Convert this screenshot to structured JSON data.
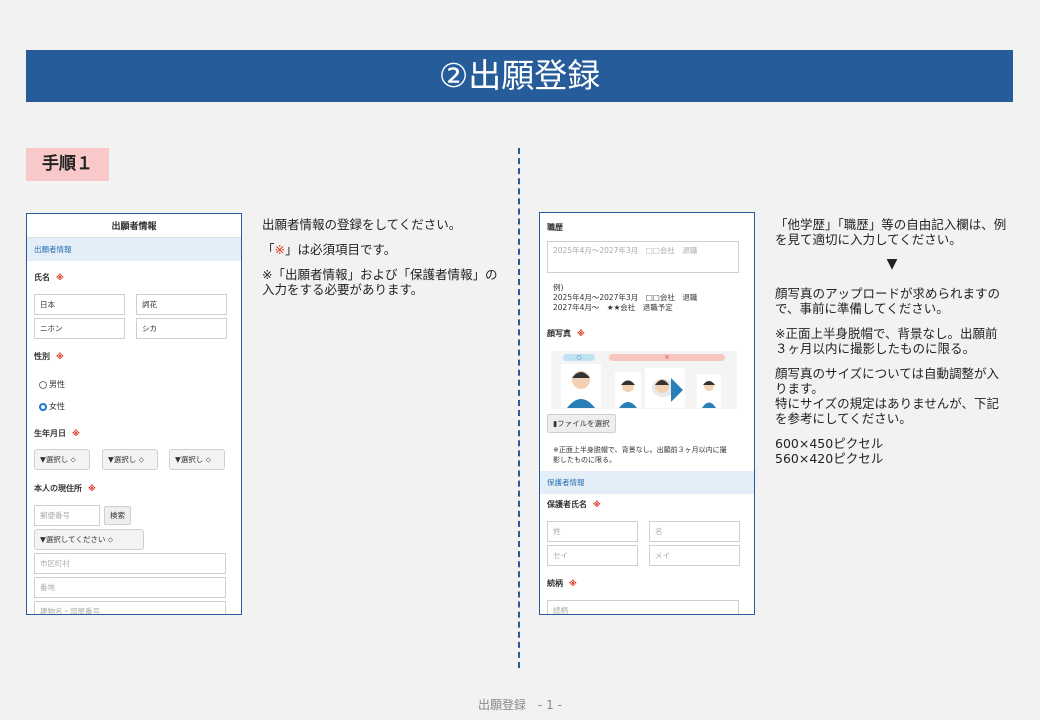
{
  "banner": {
    "title": "②出願登録"
  },
  "step": {
    "label": "手順１"
  },
  "left_text": {
    "p1": "出願者情報の登録をしてください。",
    "p2_pre": "「",
    "p2_mark": "※",
    "p2_post": "」は必須項目です。",
    "p3": "※「出願者情報」および「保護者情報」の入力をする必要があります。"
  },
  "right_text": {
    "p1": "「他学歴」「職歴」等の自由記入欄は、例を見て適切に入力してください。",
    "arrow": "▼",
    "p2": "顔写真のアップロードが求められますので、事前に準備してください。",
    "p3": "※正面上半身脱帽で、背景なし。出願前３ヶ月以内に撮影したものに限る。",
    "p4": "顔写真のサイズについては自動調整が入ります。\n特にサイズの規定はありませんが、下記を参考にしてください。",
    "p5": "600×450ピクセル\n560×420ピクセル"
  },
  "shot1": {
    "header": "出願者情報",
    "section": "出願者情報",
    "name_label": "氏名",
    "required_mark": "※",
    "last_name": "日本",
    "first_name": "詞花",
    "last_name_kana": "ニホン",
    "first_name_kana": "シカ",
    "gender_label": "性別",
    "male": "男性",
    "female": "女性",
    "birth_label": "生年月日",
    "select_year": "▼選択し ⬦",
    "select_month": "▼選択し ⬦",
    "select_day": "▼選択し ⬦",
    "address_label": "本人の現住所",
    "postal_placeholder": "郵便番号",
    "search_button": "検索",
    "prefecture_select": "▼選択してください ⬦",
    "city_placeholder": "市区町村",
    "street_placeholder": "番地",
    "building_placeholder": "建物名・部屋番号"
  },
  "shot2": {
    "career_label": "職歴",
    "career_placeholder": "2025年4月～2027年3月　□□会社　退職",
    "example_title": "例)",
    "example_line1": "2025年4月～2027年3月　□□会社　退職",
    "example_line2": "2027年4月～　★★会社　退職予定",
    "photo_label": "顔写真",
    "required_mark": "※",
    "ok_mark": "○",
    "ng_mark": "×",
    "file_button": "ファイルを選択",
    "photo_note": "※正面上半身脱帽で、背景なし。出願前３ヶ月以内に撮影したものに限る。",
    "guardian_section": "保護者情報",
    "guardian_name_label": "保護者氏名",
    "last_placeholder": "姓",
    "first_placeholder": "名",
    "last_kana_placeholder": "セイ",
    "first_kana_placeholder": "メイ",
    "relation_label": "続柄",
    "relation_placeholder": "続柄"
  },
  "footer": {
    "text": "出願登録　- 1 -"
  },
  "colors": {
    "banner": "#255c99",
    "badge": "#f9c9c9",
    "required": "#e0301e"
  }
}
